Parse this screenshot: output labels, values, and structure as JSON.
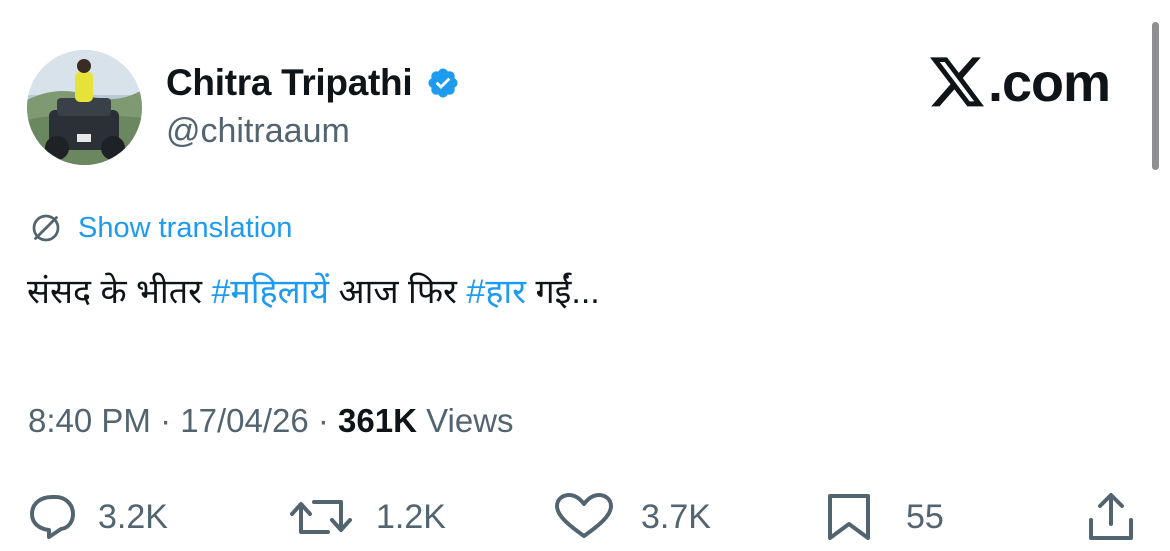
{
  "author": {
    "name": "Chitra Tripathi",
    "handle": "@chitraaum",
    "verified": true
  },
  "brand": {
    "site_suffix": ".com",
    "logo_icon": "x-logo-icon"
  },
  "translation": {
    "label": "Show translation",
    "icon": "globe-icon"
  },
  "tweet": {
    "text1": "संसद के भीतर ",
    "hashtag1": "#महिलायें",
    "text2": " आज फिर ",
    "hashtag2": "#हार",
    "text3": " गईं..."
  },
  "meta": {
    "time": "8:40 PM",
    "sep1": " · ",
    "date": "17/04/26",
    "sep2": " · ",
    "views_count": "361K",
    "views_label": " Views"
  },
  "actions": {
    "replies": "3.2K",
    "reposts": "1.2K",
    "likes": "3.7K",
    "bookmarks": "55"
  },
  "colors": {
    "link": "#1d9bf0",
    "verified": "#1d9bf0",
    "muted": "#536471",
    "text": "#0f1419"
  }
}
